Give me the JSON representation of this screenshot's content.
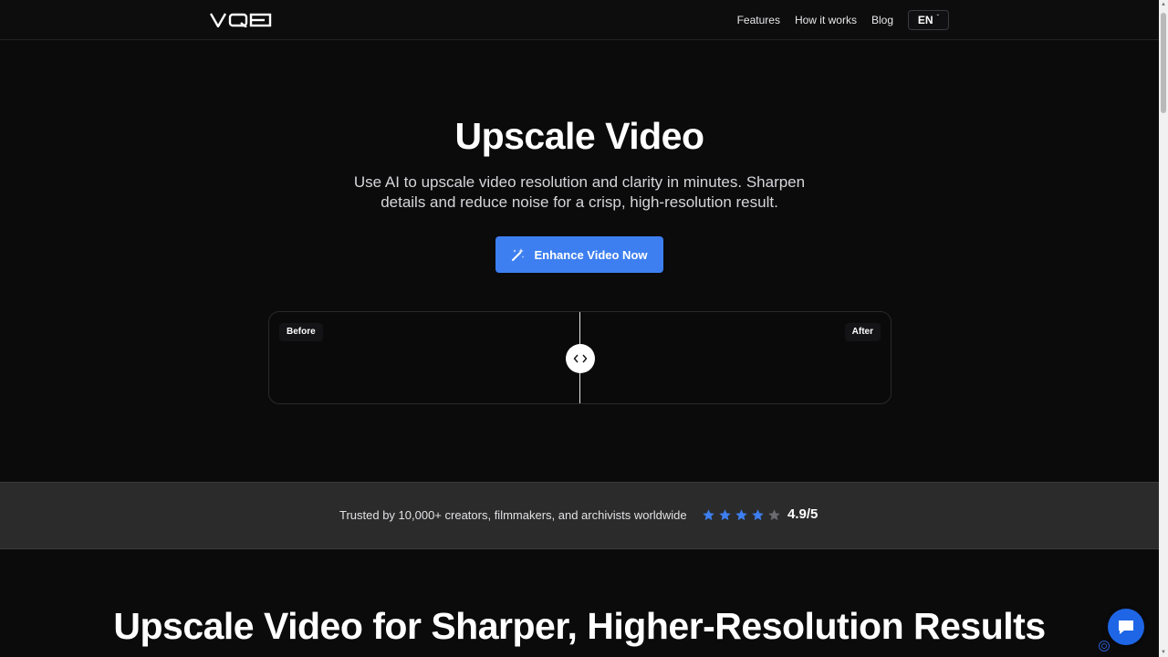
{
  "header": {
    "logo_text": "VQE",
    "nav": [
      {
        "label": "Features"
      },
      {
        "label": "How it works"
      },
      {
        "label": "Blog"
      }
    ],
    "language": "EN"
  },
  "hero": {
    "title": "Upscale Video",
    "subtitle": "Use AI to upscale video resolution and clarity in minutes. Sharpen details and reduce noise for a crisp, high-resolution result.",
    "cta_label": "Enhance Video Now",
    "cta_icon": "magic-wand-icon"
  },
  "compare": {
    "before_label": "Before",
    "after_label": "After",
    "handle_icon": "chevrons-left-right-icon"
  },
  "trust": {
    "text": "Trusted by 10,000+ creators, filmmakers, and archivists worldwide",
    "stars_filled": 4,
    "stars_total": 5,
    "rating": "4.9/5"
  },
  "section": {
    "title": "Upscale Video for Sharper, Higher-Resolution Results"
  },
  "colors": {
    "accent": "#3d7ff0",
    "background": "#0b0b0c",
    "star_filled": "#3d7ff0",
    "star_empty": "#6b6b70",
    "chat": "#1e66e6"
  },
  "chat": {
    "icon": "chat-bubble-icon"
  }
}
